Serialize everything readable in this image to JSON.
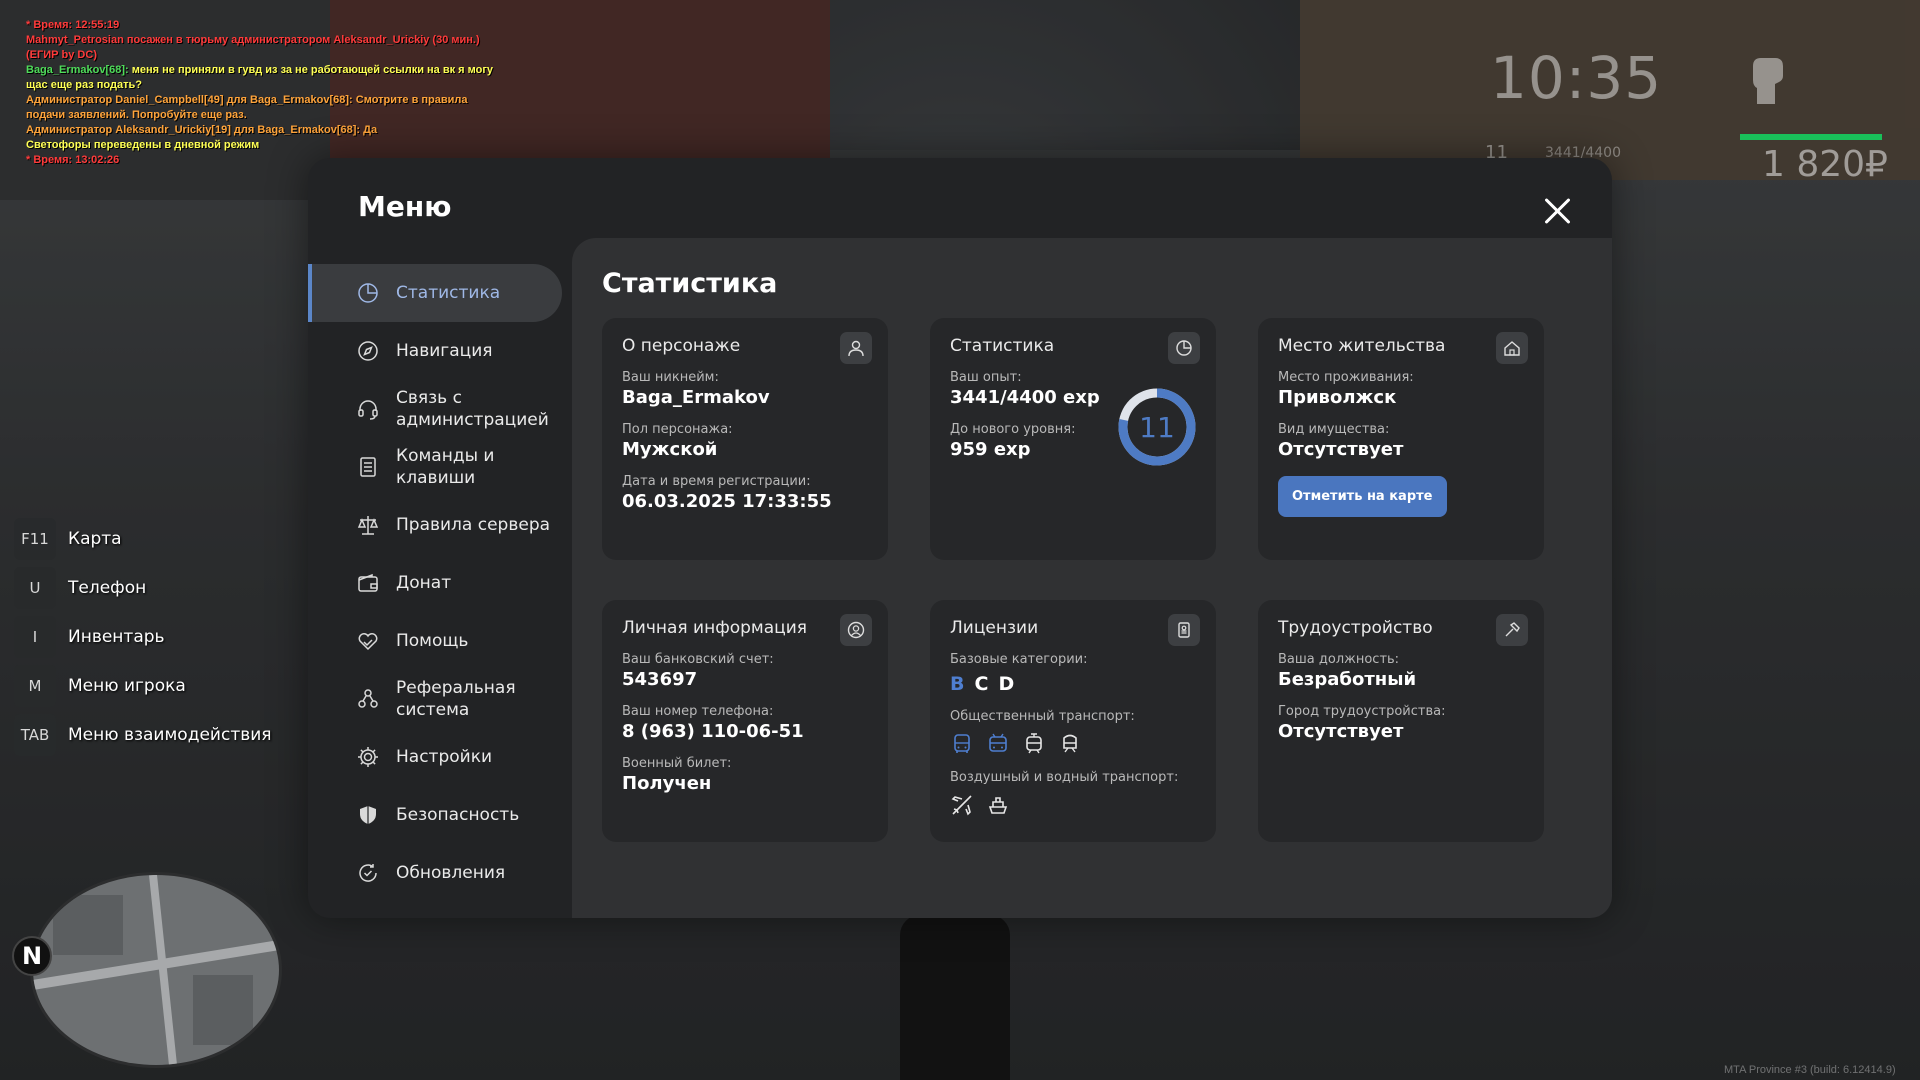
{
  "chat": [
    {
      "text": "* Время: 12:55:19",
      "color": "#ff3b3b"
    },
    {
      "text": "Mahmyt_Petrosian посажен в тюрьму администратором Aleksandr_Urickiy (30 мин.) (ЕГИР by DC)",
      "color": "#ff3b3b"
    },
    {
      "text": "Baga_Ermakov[68]:",
      "color": "#4fdc5a",
      "tail": " меня не приняли в гувд из за не работающей ссылки на вк я могу щас еще раз подать?",
      "tail_color": "#ffff55"
    },
    {
      "text": "Администратор Daniel_Campbell[49] для Baga_Ermakov[68]: Смотрите в правила подачи заявлений. Попробуйте еще раз.",
      "color": "#ffa43b"
    },
    {
      "text": "Администратор Aleksandr_Urickiy[19] для Baga_Ermakov[68]: Да",
      "color": "#ffa43b"
    },
    {
      "text": "Светофоры переведены в дневной режим",
      "color": "#ffff55"
    },
    {
      "text": "* Время: 13:02:26",
      "color": "#ff3b3b"
    }
  ],
  "hud": {
    "clock": "10:35",
    "money": "1 820₽",
    "ammo": "11",
    "ammo_total": "3441/4400",
    "health_color": "#19c05a"
  },
  "hotkeys": [
    {
      "key": "F11",
      "label": "Карта"
    },
    {
      "key": "U",
      "label": "Телефон"
    },
    {
      "key": "I",
      "label": "Инвентарь"
    },
    {
      "key": "M",
      "label": "Меню игрока"
    },
    {
      "key": "TAB",
      "label": "Меню взаимодействия"
    }
  ],
  "build": "MTA Province #3 (build: 6.12414.9)",
  "menu": {
    "title": "Меню",
    "accent": "#5b86c8",
    "nav": [
      {
        "label": "Статистика",
        "icon": "stats-pie-icon",
        "active": true
      },
      {
        "label": "Навигация",
        "icon": "compass-icon"
      },
      {
        "label": "Связь с\nадминистрацией",
        "icon": "headset-icon"
      },
      {
        "label": "Команды и\nклавиши",
        "icon": "document-list-icon"
      },
      {
        "label": "Правила сервера",
        "icon": "scales-icon"
      },
      {
        "label": "Донат",
        "icon": "wallet-icon"
      },
      {
        "label": "Помощь",
        "icon": "heart-hand-icon"
      },
      {
        "label": "Реферальная\nсистема",
        "icon": "people-network-icon"
      },
      {
        "label": "Настройки",
        "icon": "gear-icon"
      },
      {
        "label": "Безопасность",
        "icon": "shield-icon"
      },
      {
        "label": "Обновления",
        "icon": "refresh-check-icon"
      }
    ],
    "section_title": "Статистика",
    "cards": {
      "character": {
        "title": "О персонаже",
        "icon": "user-icon",
        "nickname_label": "Ваш никнейм:",
        "nickname": "Baga_Ermakov",
        "gender_label": "Пол персонажа:",
        "gender": "Мужской",
        "reg_label": "Дата и время регистрации:",
        "reg": "06.03.2025 17:33:55"
      },
      "stats": {
        "title": "Статистика",
        "icon": "pie-chart-icon",
        "exp_label": "Ваш опыт:",
        "exp": "3441/4400 exp",
        "next_label": "До нового уровня:",
        "next": "959 exp",
        "level": "11",
        "progress": 0.782
      },
      "residence": {
        "title": "Место жительства",
        "icon": "house-icon",
        "place_label": "Место проживания:",
        "place": "Приволжск",
        "property_label": "Вид имущества:",
        "property": "Отсутствует",
        "button": "Отметить на карте"
      },
      "personal": {
        "title": "Личная информация",
        "icon": "user-circle-icon",
        "bank_label": "Ваш банковский счет:",
        "bank": "543697",
        "phone_label": "Ваш номер телефона:",
        "phone": "8 (963) 110-06-51",
        "military_label": "Военный билет:",
        "military": "Получен"
      },
      "licenses": {
        "title": "Лицензии",
        "icon": "id-card-icon",
        "base_label": "Базовые категории:",
        "categories": [
          {
            "name": "B",
            "active": true
          },
          {
            "name": "C",
            "active": false
          },
          {
            "name": "D",
            "active": false
          }
        ],
        "public_label": "Общественный транспорт:",
        "public_icons": [
          "bus-icon",
          "trolleybus-icon",
          "tram-icon",
          "train-icon"
        ],
        "air_label": "Воздушный и водный транспорт:",
        "air_icons": [
          "plane-icon",
          "ship-icon"
        ]
      },
      "job": {
        "title": "Трудоустройство",
        "icon": "hammer-icon",
        "position_label": "Ваша должность:",
        "position": "Безработный",
        "city_label": "Город трудоустройства:",
        "city": "Отсутствует"
      }
    }
  }
}
